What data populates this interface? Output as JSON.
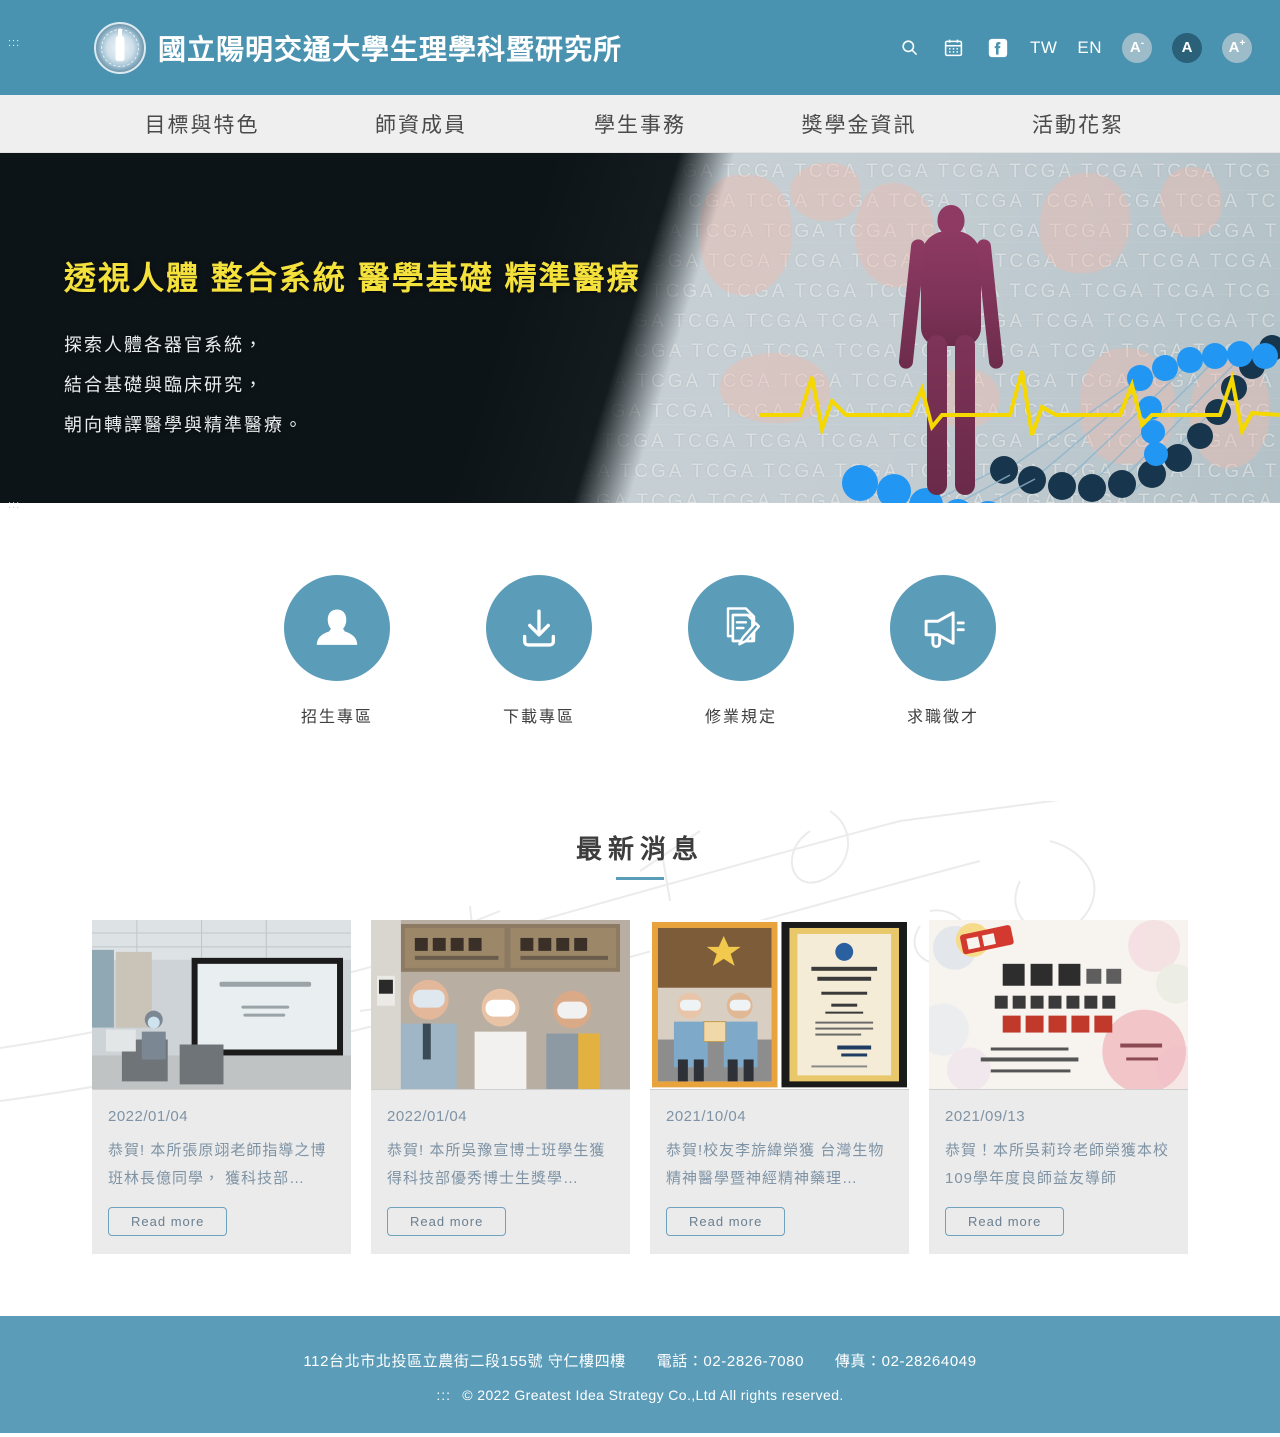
{
  "header": {
    "logo_name": "university-emblem",
    "title": "國立陽明交通大學生理學科暨研究所",
    "accessibility_marker": ":::",
    "tools": {
      "search_icon": "search-icon",
      "calendar_icon": "calendar-icon",
      "facebook_icon": "facebook-icon",
      "lang_tw": "TW",
      "lang_en": "EN",
      "font_small": "A",
      "font_small_sup": "-",
      "font_normal": "A",
      "font_large": "A",
      "font_large_sup": "+"
    },
    "brand_color": "#4a93b0"
  },
  "nav": {
    "items": [
      {
        "label": "目標與特色"
      },
      {
        "label": "師資成員"
      },
      {
        "label": "學生事務"
      },
      {
        "label": "獎學金資訊"
      },
      {
        "label": "活動花絮"
      }
    ]
  },
  "hero": {
    "accessibility_marker": ":::",
    "title": "透視人體 整合系統 醫學基礎 精準醫療",
    "lines": [
      "探索人體各器官系統，",
      "結合基礎與臨床研究，",
      "朝向轉譯醫學與精準醫療。"
    ],
    "title_color": "#f5e13c",
    "background_text": "TCGA"
  },
  "quicklinks": {
    "items": [
      {
        "label": "招生專區",
        "icon": "person-icon"
      },
      {
        "label": "下載專區",
        "icon": "download-icon"
      },
      {
        "label": "修業規定",
        "icon": "document-pen-icon"
      },
      {
        "label": "求職徵才",
        "icon": "megaphone-icon"
      }
    ],
    "accent_color": "#5b9cb8"
  },
  "news": {
    "heading": "最新消息",
    "read_more_label": "Read more",
    "cards": [
      {
        "date": "2022/01/04",
        "title": "恭賀! 本所張原翊老師指導之博班林長億同學， 獲科技部…",
        "thumb": "lecture-room-photo"
      },
      {
        "date": "2022/01/04",
        "title": "恭賀! 本所吳豫宣博士班學生獲得科技部優秀博士生獎學…",
        "thumb": "department-sign-group-photo"
      },
      {
        "date": "2021/10/04",
        "title": "恭賀!校友李旂緯榮獲 台灣生物精神醫學暨神經精神藥理…",
        "thumb": "award-ceremony-photo"
      },
      {
        "date": "2021/09/13",
        "title": "恭賀！本所吳莉玲老師榮獲本校109學年度良師益友導師",
        "thumb": "congratulation-poster"
      }
    ]
  },
  "footer": {
    "address": "112台北市北投區立農街二段155號 守仁樓四樓",
    "phone": "電話：02-2826-7080",
    "fax": "傳真：02-28264049",
    "marker": ":::",
    "copyright": "© 2022 Greatest Idea Strategy Co.,Ltd All rights reserved.",
    "background_color": "#5b9cb8"
  }
}
